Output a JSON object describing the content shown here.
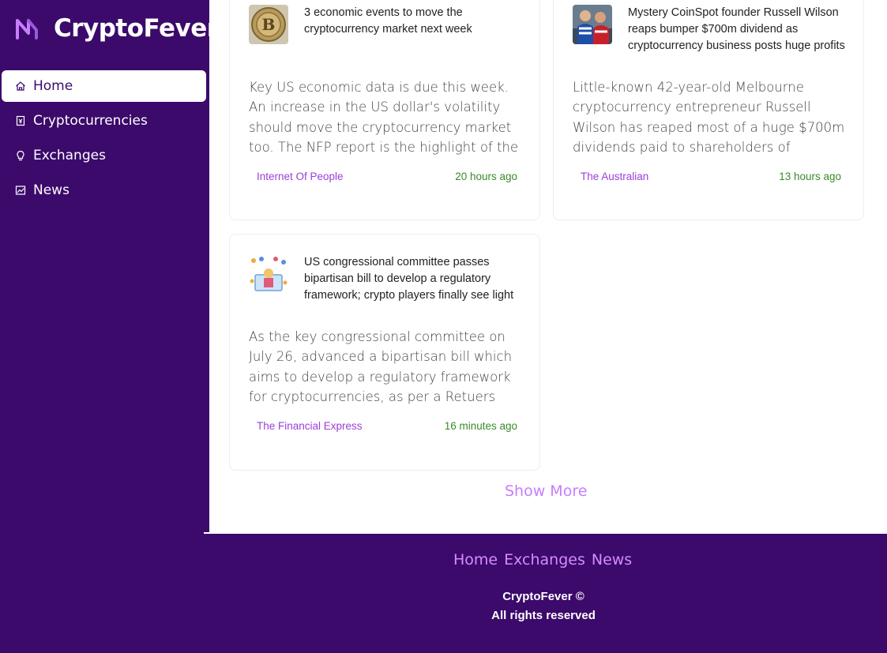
{
  "brand": {
    "name": "CryptoFever"
  },
  "sidebar": {
    "items": [
      {
        "label": "Home",
        "icon": "home-icon",
        "active": true
      },
      {
        "label": "Cryptocurrencies",
        "icon": "money-collect-icon"
      },
      {
        "label": "Exchanges",
        "icon": "bulb-icon"
      },
      {
        "label": "News",
        "icon": "fund-icon"
      }
    ]
  },
  "news": [
    {
      "title": "3 economic events to move the cryptocurrency market next week",
      "description": "Key US economic data is due this week. An increase in the US dollar's volatility should move the cryptocurrency market too. The NFP report is the highlight of the week.",
      "source": "Internet Of People",
      "time": "20 hours ago",
      "thumbnail": "bitcoin-coin-image"
    },
    {
      "title": "Mystery CoinSpot founder Russell Wilson reaps bumper $700m dividend as cryptocurrency business posts huge profits",
      "description": "Little-known 42-year-old Melbourne cryptocurrency entrepreneur Russell Wilson has reaped most of a huge $700m dividends paid to shareholders of",
      "source": "The Australian",
      "time": "13 hours ago",
      "thumbnail": "football-players-image"
    },
    {
      "title": "US congressional committee passes bipartisan bill to develop a regulatory framework; crypto players finally see light",
      "description": "As the key congressional committee on July 26, advanced a bipartisan bill which aims to develop a regulatory framework for cryptocurrencies, as per a Retuers",
      "source": "The Financial Express",
      "time": "16 minutes ago",
      "thumbnail": "crypto-illustration-image"
    }
  ],
  "show_more_label": "Show More",
  "footer": {
    "links": [
      "Home",
      "Exchanges",
      "News"
    ],
    "copyright_line1": "CryptoFever ©",
    "copyright_line2": "All rights reserved"
  },
  "colors": {
    "sidebar_bg": "#3b0a6b",
    "accent": "#c77dff",
    "source_text": "#9a3fd8",
    "time_text": "#3a8a2a"
  }
}
